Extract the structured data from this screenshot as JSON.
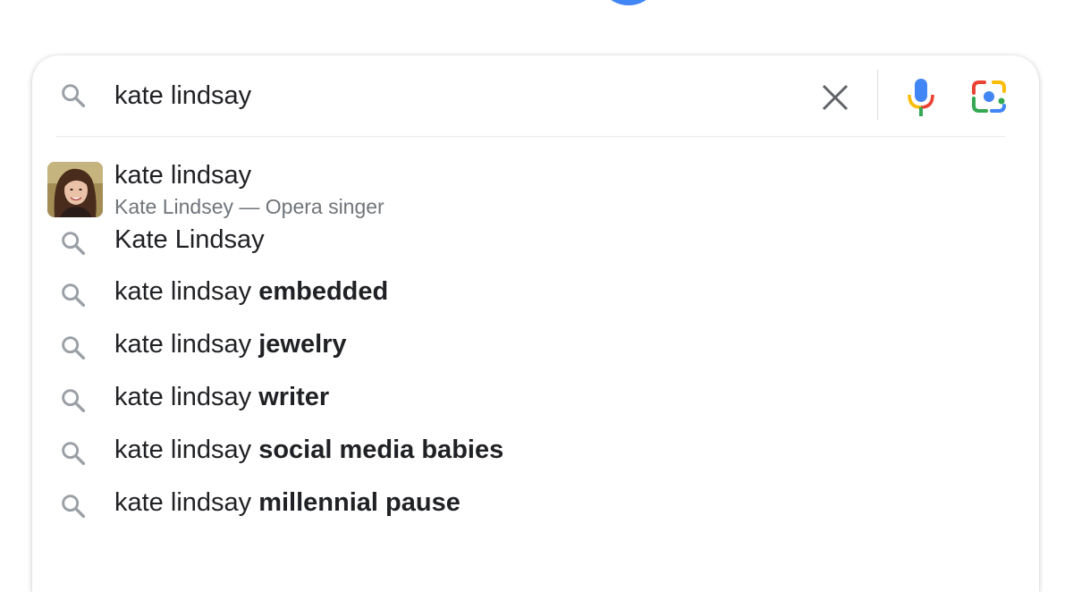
{
  "search": {
    "query": "kate lindsay",
    "icons": {
      "search": "search-icon",
      "clear": "close-icon",
      "voice": "microphone-icon",
      "lens": "camera-lens-icon"
    }
  },
  "entity_suggestion": {
    "title": "kate lindsay",
    "subtitle": "Kate Lindsey — Opera singer",
    "thumbnail": "avatar-photo"
  },
  "suggestions": [
    {
      "prefix": "",
      "completion": "",
      "plain": "Kate Lindsay"
    },
    {
      "prefix": "kate lindsay ",
      "completion": "embedded"
    },
    {
      "prefix": "kate lindsay ",
      "completion": "jewelry"
    },
    {
      "prefix": "kate lindsay ",
      "completion": "writer"
    },
    {
      "prefix": "kate lindsay ",
      "completion": "social media babies"
    },
    {
      "prefix": "kate lindsay ",
      "completion": "millennial pause"
    }
  ],
  "colors": {
    "google_blue": "#4285f4",
    "google_red": "#ea4335",
    "google_yellow": "#fbbc04",
    "google_green": "#34a853",
    "icon_gray": "#9aa0a6",
    "text": "#202124",
    "subtext": "#70757a"
  }
}
